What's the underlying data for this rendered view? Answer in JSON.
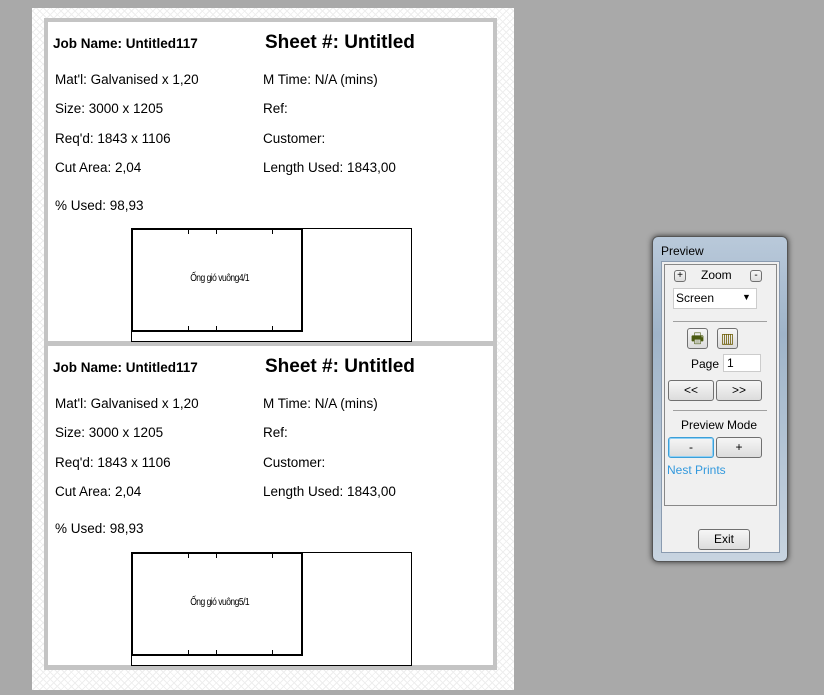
{
  "sheets": [
    {
      "job_name": "Job Name: Untitled117",
      "sheet_no": "Sheet #: Untitled",
      "material": "Mat'l: Galvanised x 1,20",
      "m_time": "M Time: N/A (mins)",
      "size": "Size: 3000 x 1205",
      "ref": "Ref:",
      "reqd": "Req'd: 1843 x 1106",
      "customer": "Customer:",
      "cut_area": "Cut Area: 2,04",
      "length_used": "Length Used: 1843,00",
      "pct_used": "% Used: 98,93",
      "part_label": "Ống gió vuông4/1"
    },
    {
      "job_name": "Job Name: Untitled117",
      "sheet_no": "Sheet #: Untitled",
      "material": "Mat'l: Galvanised x 1,20",
      "m_time": "M Time: N/A (mins)",
      "size": "Size: 3000 x 1205",
      "ref": "Ref:",
      "reqd": "Req'd: 1843 x 1106",
      "customer": "Customer:",
      "cut_area": "Cut Area: 2,04",
      "length_used": "Length Used: 1843,00",
      "pct_used": "% Used: 98,93",
      "part_label": "Ống gió vuông5/1"
    }
  ],
  "dialog": {
    "title": "Preview",
    "zoom_in": "+",
    "zoom_label": "Zoom",
    "zoom_out": "-",
    "zoom_value": "Screen",
    "page_label": "Page",
    "page_value": "1",
    "prev": "<<",
    "next": ">>",
    "mode_label": "Preview Mode",
    "mode_minus": "-",
    "mode_plus": "+",
    "nest_prints": "Nest Prints",
    "exit": "Exit",
    "link_color": "#3399dd"
  }
}
